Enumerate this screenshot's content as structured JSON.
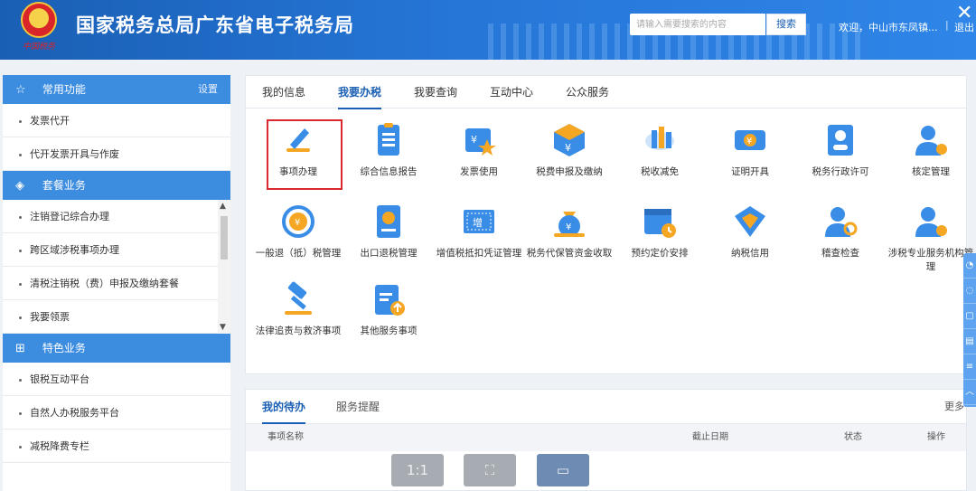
{
  "header": {
    "brand": "中国税务",
    "title": "国家税务总局广东省电子税务局",
    "search_placeholder": "请输入需要搜索的内容",
    "search_button": "搜索",
    "welcome": "欢迎，中山市东凤镇...",
    "separator": "|",
    "logout": "退出",
    "close": "✕"
  },
  "sidebar": {
    "sections": [
      {
        "title": "常用功能",
        "icon": "star-icon",
        "action": "设置",
        "items": [
          "发票代开",
          "代开发票开具与作废"
        ]
      },
      {
        "title": "套餐业务",
        "icon": "layers-icon",
        "items": [
          "注销登记综合办理",
          "跨区域涉税事项办理",
          "清税注销税（费）申报及缴纳套餐",
          "我要领票"
        ]
      },
      {
        "title": "特色业务",
        "icon": "grid-icon",
        "items": [
          "银税互动平台",
          "自然人办税服务平台",
          "减税降费专栏"
        ]
      }
    ]
  },
  "tabs": [
    "我的信息",
    "我要办税",
    "我要查询",
    "互动中心",
    "公众服务"
  ],
  "active_tab": "我要办税",
  "grid": [
    {
      "label": "事项办理",
      "icon": "pen-icon",
      "selected": true
    },
    {
      "label": "综合信息报告",
      "icon": "document-list-icon"
    },
    {
      "label": "发票使用",
      "icon": "invoice-star-icon"
    },
    {
      "label": "税费申报及缴纳",
      "icon": "tax-cube-icon"
    },
    {
      "label": "税收减免",
      "icon": "coin-stack-icon"
    },
    {
      "label": "证明开具",
      "icon": "certificate-icon"
    },
    {
      "label": "税务行政许可",
      "icon": "id-card-icon"
    },
    {
      "label": "核定管理",
      "icon": "user-gear-icon"
    },
    {
      "label": "一般退（抵）税管理",
      "icon": "refund-cycle-icon"
    },
    {
      "label": "出口退税管理",
      "icon": "yen-document-icon"
    },
    {
      "label": "增值税抵扣凭证管理",
      "icon": "vat-ticket-icon"
    },
    {
      "label": "税务代保管资金收取",
      "icon": "money-bag-icon"
    },
    {
      "label": "预约定价安排",
      "icon": "calendar-clock-icon"
    },
    {
      "label": "纳税信用",
      "icon": "diamond-shield-icon"
    },
    {
      "label": "稽查检查",
      "icon": "user-search-icon"
    },
    {
      "label": "涉税专业服务机构管理",
      "icon": "user-settings-icon"
    },
    {
      "label": "法律追责与救济事项",
      "icon": "gavel-icon"
    },
    {
      "label": "其他服务事项",
      "icon": "clipboard-upload-icon"
    }
  ],
  "todo": {
    "tabs": [
      "我的待办",
      "服务提醒"
    ],
    "more": "更多",
    "columns": [
      "事项名称",
      "截止日期",
      "状态",
      "操作"
    ]
  },
  "viewer": {
    "buttons": [
      "1:1",
      "⛶",
      "▭"
    ]
  },
  "colors": {
    "primary": "#1a5fb4",
    "header": "#2575d6",
    "selected_border": "#d9292c",
    "icon_blue": "#3a8de6",
    "icon_orange": "#f5a623"
  }
}
